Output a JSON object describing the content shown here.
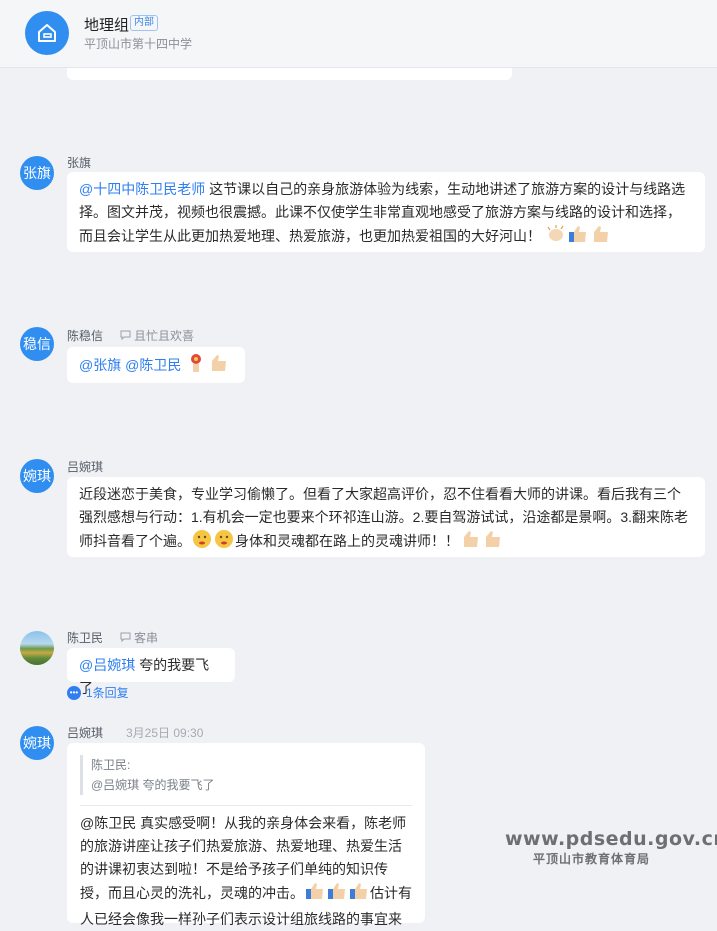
{
  "header": {
    "group_name": "地理组",
    "tag": "内部",
    "subtitle": "平顶山市第十四中学"
  },
  "messages": [
    {
      "avatar": "张旗",
      "name": "张旗",
      "mention": "@十四中陈卫民老师",
      "text": " 这节课以自己的亲身旅游体验为线索，生动地讲述了旅游方案的设计与线路选择。图文并茂，视频也很震撼。此课不仅使学生非常直观地感受了旅游方案与线路的设计和选择，而且会让学生从此更加热爱地理、热爱旅游，也更加热爱祖国的大好河山！",
      "emojis": [
        "clap-emoji",
        "thumbs-up-emoji",
        "thumbs-up-emoji"
      ]
    },
    {
      "avatar": "稳信",
      "name": "陈稳信",
      "status": "且忙且欢喜",
      "mention": "@张旗 @陈卫民",
      "emojis": [
        "flower-emoji",
        "thumbs-up-emoji"
      ]
    },
    {
      "avatar": "婉琪",
      "name": "吕婉琪",
      "text1": "近段迷恋于美食，专业学习偷懒了。但看了大家超高评价，忍不住看看大师的讲课。看后我有三个强烈感想与行动：1.有机会一定也要来个环祁连山游。2.要自驾游试试，沿途都是景啊。3.翻来陈老师抖音看了个遍。",
      "text2": "身体和灵魂都在路上的灵魂讲师！！",
      "emojis_mid": [
        "shy-face-emoji",
        "shy-face-emoji"
      ],
      "emojis_end": [
        "thumbs-up-emoji",
        "thumbs-up-emoji"
      ]
    },
    {
      "name": "陈卫民",
      "status": "客串",
      "mention": "@吕婉琪",
      "text": " 夸的我要飞了",
      "reply_count": "1条回复"
    },
    {
      "avatar": "婉琪",
      "name": "吕婉琪",
      "time": "3月25日 09:30",
      "quote_author": "陈卫民:",
      "quote_text": "@吕婉琪 夸的我要飞了",
      "text1": "@陈卫民 真实感受啊！从我的亲身体会来看，陈老师的旅游讲座让孩子们热爱旅游、热爱地理、热爱生活的讲课初衷达到啦！不是给予孩子们单纯的知识传授，而且心灵的洗礼，灵魂的冲击。",
      "text2": "估计有人已经会像我一样孙子们表示设计组旅线路的事宜来"
    }
  ],
  "watermark": {
    "url": "www.pdsedu.gov.cn",
    "org": "平顶山市教育体育局"
  },
  "colors": {
    "accent": "#2f8ef0",
    "mention": "#2f7ff0",
    "background": "#f0f1f4"
  }
}
